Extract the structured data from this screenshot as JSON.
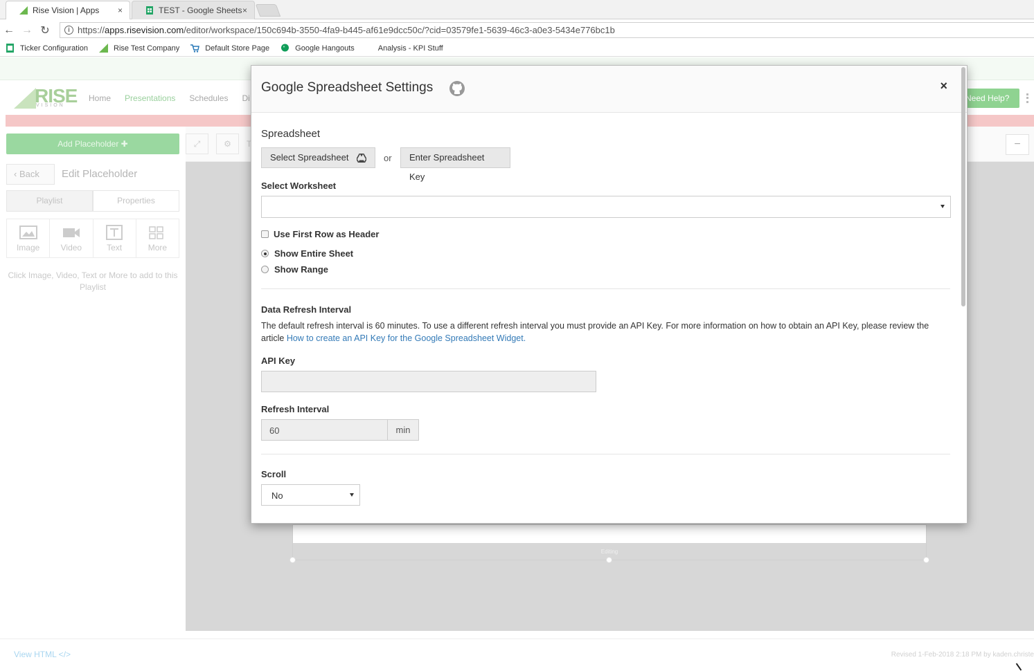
{
  "browser": {
    "tabs": [
      {
        "label": "Rise Vision | Apps",
        "close": "×"
      },
      {
        "label": "TEST - Google Sheets",
        "close": "×"
      }
    ],
    "url_prefix": "https://",
    "url_host": "apps.risevision.com",
    "url_path": "/editor/workspace/150c694b-3550-4fa9-b445-af61e9dcc50c/?cid=03579fe1-5639-46c3-a0e3-5434e776bc1b",
    "bookmarks": [
      {
        "label": "Ticker Configuration",
        "icon": "sheets-icon"
      },
      {
        "label": "Rise Test Company",
        "icon": "rise-icon"
      },
      {
        "label": "Default Store Page",
        "icon": "cart-icon"
      },
      {
        "label": "Google Hangouts",
        "icon": "hangouts-icon"
      },
      {
        "label": "Analysis - KPI Stuff",
        "icon": "none"
      }
    ]
  },
  "app": {
    "logo": "RISE",
    "logo_sub": "VISION",
    "nav": [
      "Home",
      "Presentations",
      "Schedules",
      "Di"
    ],
    "help": "Need Help?",
    "add_placeholder": "Add Placeholder  ✚",
    "back": "‹  Back",
    "edit_placeholder": "Edit Placeholder",
    "tabs": [
      "Playlist",
      "Properties"
    ],
    "media": [
      "Image",
      "Video",
      "Text",
      "More"
    ],
    "hint": "Click Image, Video, Text or More to add to this Playlist",
    "toolbar_letter": "T",
    "placeholder_label": "Editing",
    "view_html": "View HTML </>",
    "revised": "Revised 1-Feb-2018 2:18 PM by kaden.christe"
  },
  "modal": {
    "title": "Google Spreadsheet Settings",
    "close": "×",
    "spreadsheet_label": "Spreadsheet",
    "select_spreadsheet": "Select Spreadsheet",
    "or": "or",
    "enter_key": "Enter Spreadsheet Key",
    "worksheet_label": "Select Worksheet",
    "worksheet_value": "",
    "first_row_header": "Use First Row as Header",
    "show_entire_sheet": "Show Entire Sheet",
    "show_range": "Show Range",
    "refresh_heading": "Data Refresh Interval",
    "refresh_desc": "The default refresh interval is 60 minutes. To use a different refresh interval you must provide an API Key. For more information on how to obtain an API Key, please review the article ",
    "refresh_link": "How to create an API Key for the Google Spreadsheet Widget.",
    "api_key_label": "API Key",
    "api_key_value": "",
    "refresh_interval_label": "Refresh Interval",
    "refresh_interval_value": "60",
    "refresh_unit": "min",
    "scroll_label": "Scroll",
    "scroll_value": "No"
  },
  "colors": {
    "accent_green": "#8fd391",
    "link_blue": "#337ab7",
    "alert_pink": "#f5c7c7"
  }
}
